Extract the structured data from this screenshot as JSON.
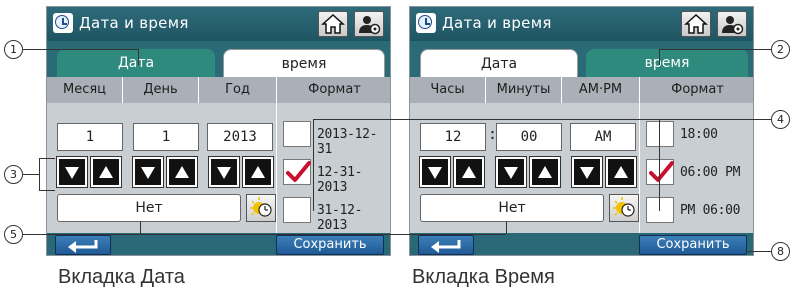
{
  "date_screen": {
    "title": "Дата и время",
    "tabs": [
      {
        "label": "Дата",
        "active": true
      },
      {
        "label": "время",
        "active": false
      }
    ],
    "columns": [
      "Месяц",
      "День",
      "Год",
      "Формат"
    ],
    "values": [
      "1",
      "1",
      "2013"
    ],
    "dst_value": "Нет",
    "formats": [
      {
        "label": "2013-12-31",
        "checked": false
      },
      {
        "label": "12-31-2013",
        "checked": true
      },
      {
        "label": "31-12-2013",
        "checked": false
      }
    ],
    "save_label": "Сохранить",
    "caption": "Вкладка Дата"
  },
  "time_screen": {
    "title": "Дата и время",
    "tabs": [
      {
        "label": "Дата",
        "active": false
      },
      {
        "label": "время",
        "active": true
      }
    ],
    "columns": [
      "Часы",
      "Минуты",
      "AM·PM",
      "Формат"
    ],
    "values": [
      "12",
      "00",
      "AM"
    ],
    "separator": ":",
    "dst_value": "Нет",
    "formats": [
      {
        "label": "18:00",
        "checked": false
      },
      {
        "label": "06:00 PM",
        "checked": true
      },
      {
        "label": "PM 06:00",
        "checked": false
      }
    ],
    "save_label": "Сохранить",
    "caption": "Вкладка Время"
  },
  "callouts": [
    "1",
    "2",
    "3",
    "4",
    "5",
    "8"
  ],
  "colors": {
    "title_bar": "#2f6b7a",
    "active_tab": "#2f8a7e",
    "column_header": "#a9b0b7",
    "panel": "#c9ced3",
    "blue_button": "#2a6fa8",
    "check_mark": "#c8102e"
  },
  "icons": [
    "clock-icon",
    "home-icon",
    "user-settings-icon",
    "arrow-down-icon",
    "arrow-up-icon",
    "daylight-saving-icon",
    "check-icon",
    "back-arrow-icon"
  ]
}
